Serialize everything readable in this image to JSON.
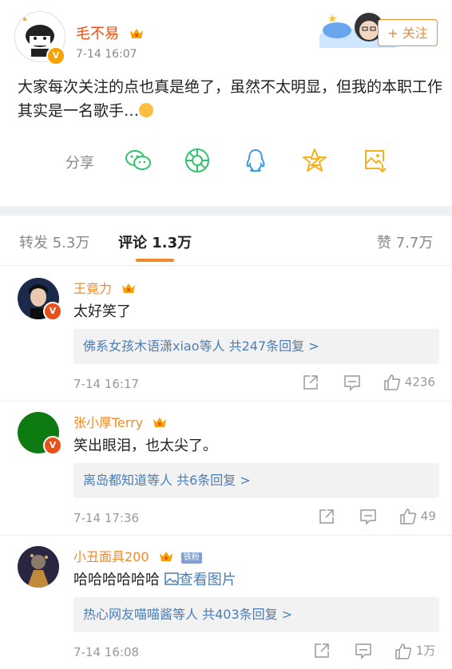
{
  "post": {
    "author": "毛不易",
    "time": "7-14 16:07",
    "follow_label": "+ 关注",
    "text": "大家每次关注的点也真是绝了，虽然不太明显，但我的本职工作其实是一名歌手…",
    "share_label": "分享",
    "share_icons": [
      "wechat-icon",
      "moments-icon",
      "qq-icon",
      "qzone-icon",
      "save-image-icon"
    ]
  },
  "tabs": {
    "repost": "转发 5.3万",
    "comments": "评论 1.3万",
    "likes": "赞 7.7万"
  },
  "comments": [
    {
      "name": "王竟力",
      "text": "太好笑了",
      "replies": "佛系女孩木语潇xiao等人  共247条回复 >",
      "time": "7-14 16:17",
      "likes": "4236"
    },
    {
      "name": "张小厚Terry",
      "text": "笑出眼泪，也太尖了。",
      "replies": "离岛都知道等人  共6条回复 >",
      "time": "7-14 17:36",
      "likes": "49"
    },
    {
      "name": "小丑面具200",
      "fan_badge": "铁粉",
      "text": "哈哈哈哈哈哈 ",
      "pic_link": "查看图片",
      "replies": "热心网友喵喵酱等人  共403条回复 >",
      "time": "7-14 16:08",
      "likes": "1万"
    }
  ],
  "colors": {
    "accent_orange": "#f08a2c",
    "name_red": "#f04b0c",
    "link_blue": "#4a7eb8",
    "share_green": "#2fc46b",
    "share_blue": "#3b9be8",
    "share_yellow": "#f6b21b"
  }
}
